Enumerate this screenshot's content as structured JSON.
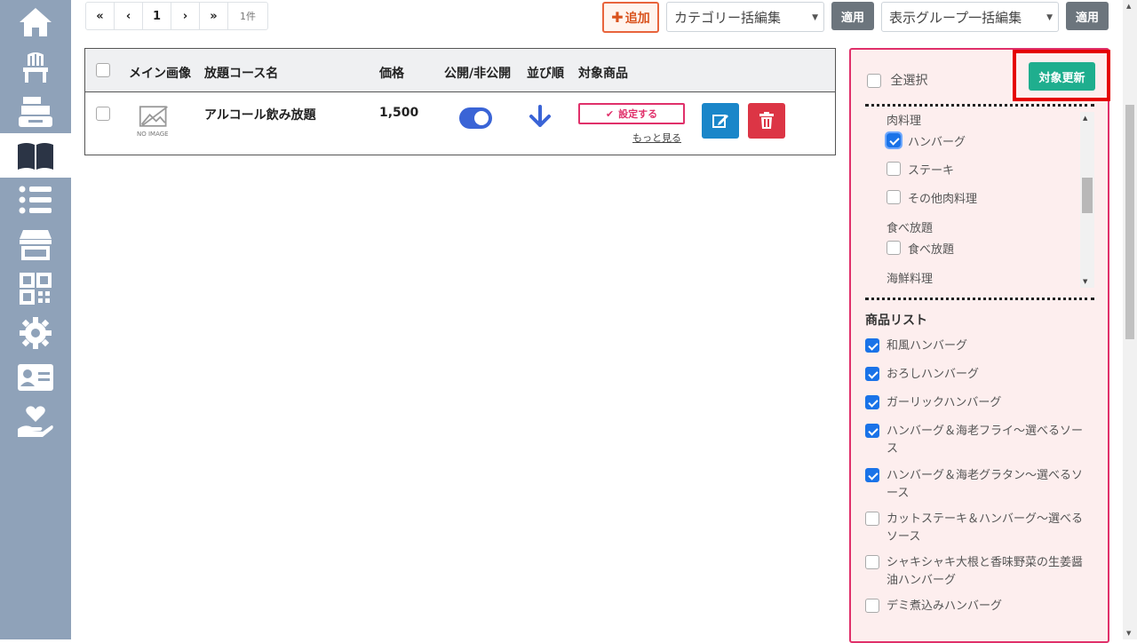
{
  "sidebar": {
    "items": [
      {
        "icon": "home-icon"
      },
      {
        "icon": "chair-icon"
      },
      {
        "icon": "cash-register-icon"
      },
      {
        "icon": "book-icon"
      },
      {
        "icon": "list-icon"
      },
      {
        "icon": "store-icon"
      },
      {
        "icon": "qr-code-icon"
      },
      {
        "icon": "gear-icon"
      },
      {
        "icon": "id-card-icon"
      },
      {
        "icon": "hand-heart-icon"
      }
    ],
    "active_index": 3
  },
  "pager": {
    "first": "«",
    "prev": "‹",
    "page": "1",
    "next": "›",
    "last": "»",
    "count": "1件"
  },
  "toolbar": {
    "add_label": "追加",
    "category_select": "カテゴリー括編集",
    "category_apply": "適用",
    "display_group_select": "表示グループ一括編集",
    "display_group_apply": "適用"
  },
  "table": {
    "headers": {
      "image": "メイン画像",
      "name": "放題コース名",
      "price": "価格",
      "visibility": "公開/非公開",
      "order": "並び順",
      "target": "対象商品"
    },
    "rows": [
      {
        "image_placeholder": "NO IMAGE",
        "name": "アルコール飲み放題",
        "price": "1,500",
        "published": true,
        "set_label": "設定する",
        "more_label": "もっと見る"
      }
    ]
  },
  "panel": {
    "select_all": "全選択",
    "update_button": "対象更新",
    "categories": [
      {
        "group": "肉料理",
        "items": [
          {
            "label": "ハンバーグ",
            "checked": true
          },
          {
            "label": "ステーキ",
            "checked": false
          },
          {
            "label": "その他肉料理",
            "checked": false
          }
        ]
      },
      {
        "group": "食べ放題",
        "items": [
          {
            "label": "食べ放題",
            "checked": false
          }
        ]
      },
      {
        "group": "海鮮料理",
        "items": []
      }
    ],
    "product_list_title": "商品リスト",
    "products": [
      {
        "label": "和風ハンバーグ",
        "checked": true
      },
      {
        "label": "おろしハンバーグ",
        "checked": true
      },
      {
        "label": "ガーリックハンバーグ",
        "checked": true
      },
      {
        "label": "ハンバーグ＆海老フライ〜選べるソース",
        "checked": true
      },
      {
        "label": "ハンバーグ＆海老グラタン〜選べるソース",
        "checked": true
      },
      {
        "label": "カットステーキ＆ハンバーグ〜選べるソース",
        "checked": false
      },
      {
        "label": "シャキシャキ大根と香味野菜の生姜醤油ハンバーグ",
        "checked": false
      },
      {
        "label": "デミ煮込みハンバーグ",
        "checked": false
      }
    ]
  },
  "colors": {
    "sidebar_bg": "#8fa2b9",
    "accent_pink": "#e0306a",
    "update_green": "#1fae8e",
    "edit_blue": "#1a86c9",
    "delete_red": "#dc3545",
    "toggle_blue": "#3a64d6"
  }
}
